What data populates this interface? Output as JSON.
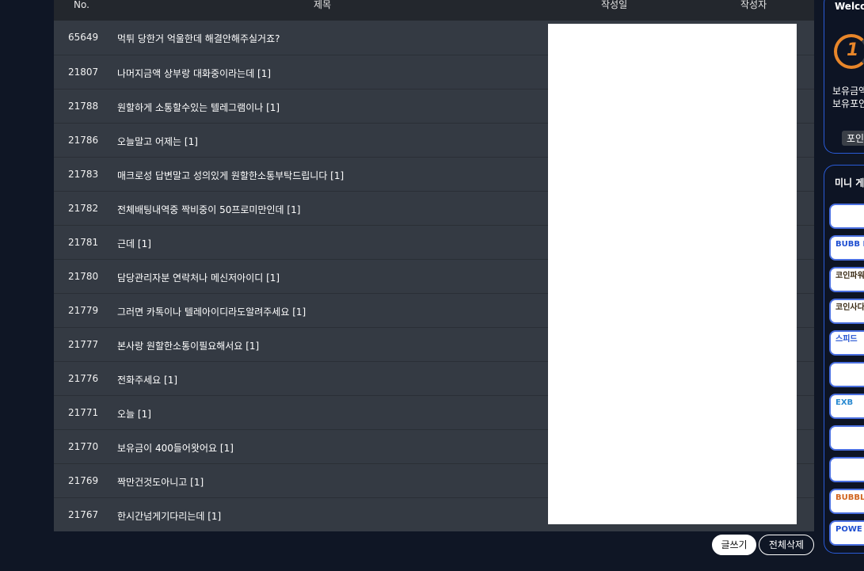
{
  "table": {
    "headers": {
      "no": "No.",
      "title": "제목",
      "date": "작성일",
      "author": "작성자"
    },
    "rows": [
      {
        "no": "65649",
        "title": "먹튀 당한거 억울한데 해결안해주실거죠?"
      },
      {
        "no": "21807",
        "title": "나머지금액 상부랑 대화중이라는데 [1]"
      },
      {
        "no": "21788",
        "title": "원할하게 소통할수있는 텔레그램이나 [1]"
      },
      {
        "no": "21786",
        "title": "오늘말고 어제는 [1]"
      },
      {
        "no": "21783",
        "title": "매크로성 답변말고 성의있게 원할한소통부탁드립니다 [1]"
      },
      {
        "no": "21782",
        "title": "전체배팅내역중 짝비중이 50프로미만인데 [1]"
      },
      {
        "no": "21781",
        "title": "근데 [1]"
      },
      {
        "no": "21780",
        "title": "담당관리자분 연락처나 메신저아이디 [1]"
      },
      {
        "no": "21779",
        "title": "그러면 카톡이나 텔레아이디라도알려주세요 [1]"
      },
      {
        "no": "21777",
        "title": "본사랑 원할한소통이필요해서요 [1]"
      },
      {
        "no": "21776",
        "title": "전화주세요 [1]"
      },
      {
        "no": "21771",
        "title": "오늘 [1]"
      },
      {
        "no": "21770",
        "title": "보유금이 400들어왓어요 [1]"
      },
      {
        "no": "21769",
        "title": "짝만건것도아니고 [1]"
      },
      {
        "no": "21767",
        "title": "한시간넘게기다리는데 [1]"
      }
    ]
  },
  "buttons": {
    "write": "글쓰기",
    "delete_all": "전체삭제"
  },
  "user_panel": {
    "welcome": "Welco",
    "level": "1",
    "line1": "보유금액",
    "line2": "보유포인",
    "point_button": "포인"
  },
  "mini_games": {
    "title": "미니 게",
    "tiles": [
      {
        "label": "",
        "color": "#c0392b"
      },
      {
        "label": "BUBB POWERB",
        "color": "#1f4fd1"
      },
      {
        "label": "코인파워",
        "color": "#3a2a14"
      },
      {
        "label": "코인사다리",
        "color": "#3a2a14"
      },
      {
        "label": "스피드",
        "color": "#1f4fd1"
      },
      {
        "label": "",
        "color": "#1f4fd1"
      },
      {
        "label": "EXB",
        "color": "#2a8ad1"
      },
      {
        "label": "",
        "color": "#1f4fd1"
      },
      {
        "label": "",
        "color": "#1f4fd1"
      },
      {
        "label": "BUBBLE LAD",
        "color": "#d1651f"
      },
      {
        "label": "POWE BALL",
        "color": "#1f4fd1"
      }
    ]
  }
}
